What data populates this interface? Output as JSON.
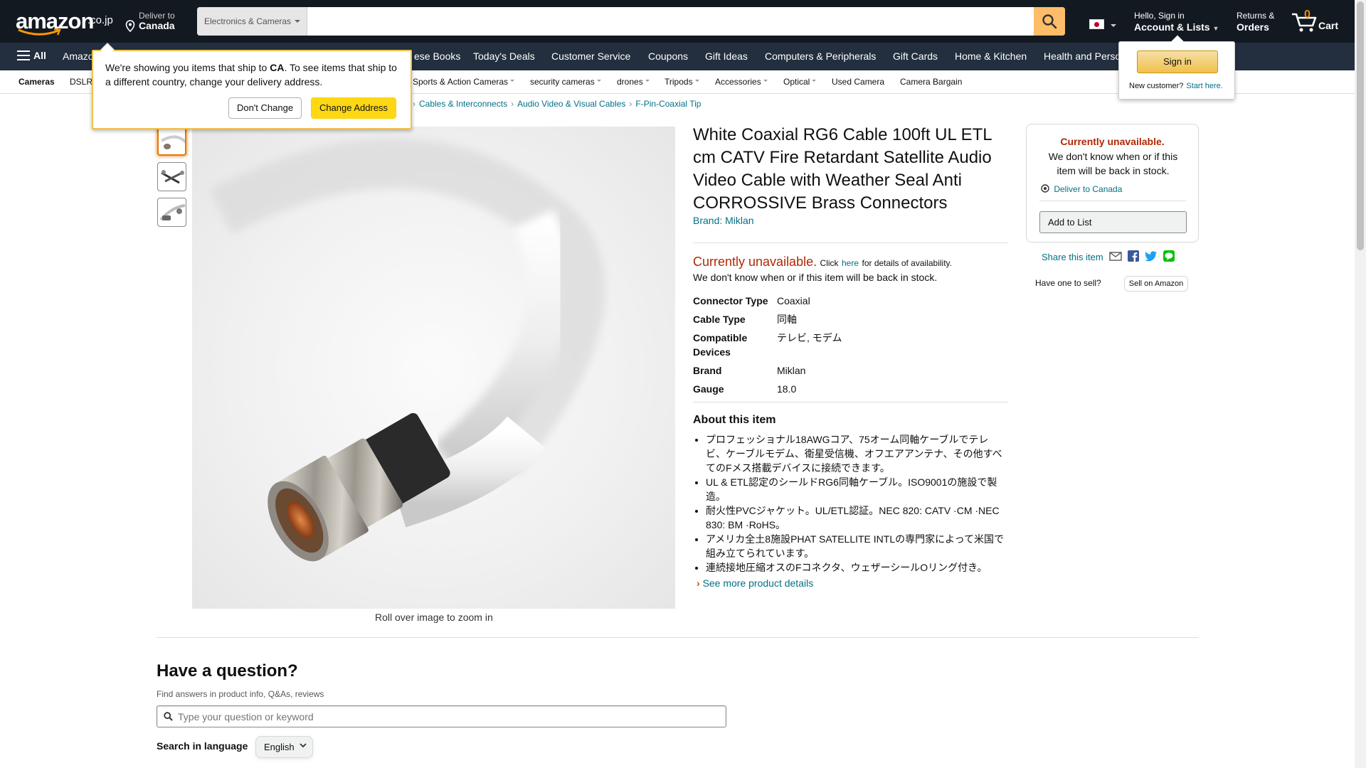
{
  "header": {
    "logo_text": "amazon",
    "logo_tld": ".co.jp",
    "deliver_line1": "Deliver to",
    "deliver_line2": "Canada",
    "search_category": "Electronics & Cameras",
    "search_value": "",
    "account_line1": "Hello, Sign in",
    "account_line2": "Account & Lists",
    "returns_line1": "Returns &",
    "returns_line2": "Orders",
    "cart_count": "0",
    "cart_label": "Cart"
  },
  "nav": {
    "all_label": "All",
    "items": [
      "Amazon",
      "ese Books",
      "Today's Deals",
      "Customer Service",
      "Coupons",
      "Gift Ideas",
      "Computers & Peripherals",
      "Gift Cards",
      "Home & Kitchen",
      "Health and Perso"
    ]
  },
  "subnav": {
    "items": [
      "Cameras",
      "DSLR",
      "Sports & Action Cameras",
      "security cameras",
      "drones",
      "Tripods",
      "Accessories",
      "Optical",
      "Used Camera",
      "Camera Bargain"
    ]
  },
  "breadcrumbs": [
    "Cables & Interconnects",
    "Audio Video & Visual Cables",
    "F-Pin-Coaxial Tip"
  ],
  "gallery": {
    "zoom_hint": "Roll over image to zoom in"
  },
  "product": {
    "title": "White Coaxial RG6 Cable 100ft UL ETL cm CATV Fire Retardant Satellite Audio Video Cable with Weather Seal Anti CORROSSIVE Brass Connectors",
    "brand_link": "Brand: Miklan",
    "unavailable": "Currently unavailable.",
    "click": "Click",
    "here": "here",
    "details": "for details of availability.",
    "unknown": "We don't know when or if this item will be back in stock.",
    "specs": [
      {
        "k": "Connector Type",
        "v": "Coaxial"
      },
      {
        "k": "Cable Type",
        "v": "同軸"
      },
      {
        "k": "Compatible Devices",
        "v": "テレビ, モデム"
      },
      {
        "k": "Brand",
        "v": "Miklan"
      },
      {
        "k": "Gauge",
        "v": "18.0"
      }
    ],
    "about_heading": "About this item",
    "bullets": [
      "プロフェッショナル18AWGコア、75オーム同軸ケーブルでテレビ、ケーブルモデム、衛星受信機、オフエアアンテナ、その他すべてのFメス搭載デバイスに接続できます。",
      "UL & ETL認定のシールドRG6同軸ケーブル。ISO9001の施設で製造。",
      "耐火性PVCジャケット。UL/ETL認証。NEC 820: CATV ·CM ·NEC 830: BM ·RoHS。",
      "アメリカ全土8施設PHAT SATELLITE INTLの専門家によって米国で組み立てられています。",
      "連続接地圧縮オスのFコネクタ、ウェザーシールOリング付き。"
    ],
    "see_more": "See more product details"
  },
  "buybox": {
    "unavailable": "Currently unavailable.",
    "message": "We don't know when or if this item will be back in stock.",
    "deliver": "Deliver to Canada",
    "add_to_list": "Add to List",
    "share": "Share this item",
    "have_one": "Have one to sell?",
    "sell_btn": "Sell on Amazon"
  },
  "questions": {
    "heading": "Have a question?",
    "sub": "Find answers in product info, Q&As, reviews",
    "placeholder": "Type your question or keyword",
    "lang_label": "Search in language",
    "lang_value": "English"
  },
  "popover": {
    "msg_pre": "We're showing you items that ship to",
    "msg_country": "CA",
    "msg_post": ". To see items that ship to a different country, change your delivery address.",
    "dont_change": "Don't Change",
    "change_address": "Change Address"
  },
  "signin_flyout": {
    "button": "Sign in",
    "new_customer": "New customer?",
    "start_here": "Start here."
  },
  "colors": {
    "header_bg": "#131921",
    "nav_bg": "#232f3e",
    "search_btn": "#febd69",
    "link": "#007185",
    "price_red": "#b12704",
    "cart_orange": "#f08804"
  }
}
